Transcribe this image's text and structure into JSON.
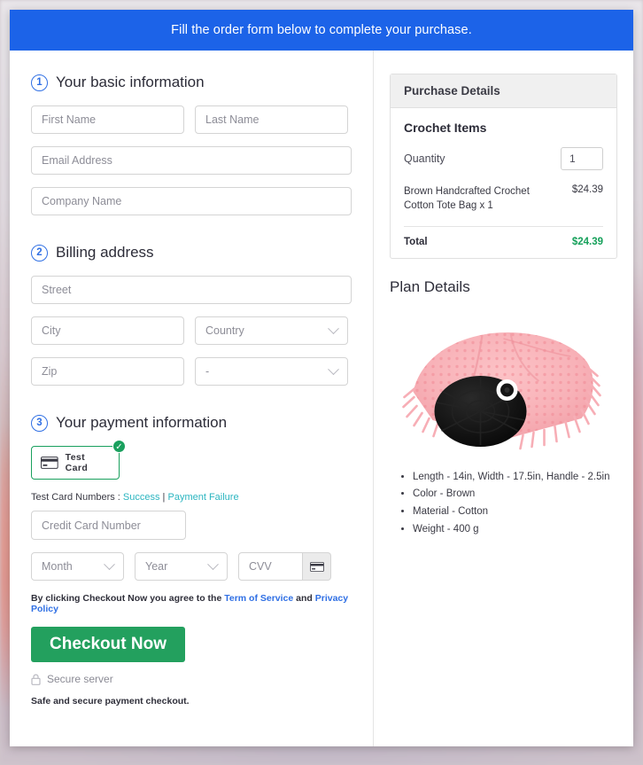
{
  "banner": {
    "text": "Fill the order form below to complete your purchase."
  },
  "steps": [
    {
      "num": "1",
      "title": "Your basic information"
    },
    {
      "num": "2",
      "title": "Billing address"
    },
    {
      "num": "3",
      "title": "Your payment information"
    }
  ],
  "basic": {
    "first_name_placeholder": "First Name",
    "last_name_placeholder": "Last Name",
    "email_placeholder": "Email Address",
    "company_placeholder": "Company Name"
  },
  "billing": {
    "street_placeholder": "Street",
    "city_placeholder": "City",
    "country_placeholder": "Country",
    "zip_placeholder": "Zip",
    "state_placeholder": "-"
  },
  "payment": {
    "card_option_label": "Test Card",
    "card_option_selected": true,
    "check_glyph": "✓",
    "test_prefix": "Test Card Numbers : ",
    "test_success": "Success",
    "test_separator": " | ",
    "test_failure": "Payment Failure",
    "cc_placeholder": "Credit Card Number",
    "month_placeholder": "Month",
    "year_placeholder": "Year",
    "cvv_placeholder": "CVV",
    "terms_prefix": "By clicking Checkout Now you agree to the ",
    "terms_link": "Term of Service",
    "terms_mid": " and ",
    "privacy_link": "Privacy Policy",
    "checkout_label": "Checkout Now",
    "secure_label": "Secure server",
    "safe_note": "Safe and secure payment checkout."
  },
  "purchase": {
    "header": "Purchase Details",
    "items_title": "Crochet Items",
    "quantity_label": "Quantity",
    "quantity_value": "1",
    "item_name": "Brown Handcrafted Crochet Cotton Tote Bag x 1",
    "item_price": "$24.39",
    "total_label": "Total",
    "total_value": "$24.39"
  },
  "plan": {
    "title": "Plan Details",
    "specs": [
      "Length - 14in, Width - 17.5in, Handle - 2.5in",
      "Color - Brown",
      "Material - Cotton",
      "Weight - 400 g"
    ]
  },
  "colors": {
    "banner_blue": "#1c63e8",
    "step_blue": "#2f6fe4",
    "success_green": "#23a05e",
    "total_green": "#15a05a",
    "link_teal": "#2bb5c0",
    "link_blue": "#2f6fe4"
  }
}
